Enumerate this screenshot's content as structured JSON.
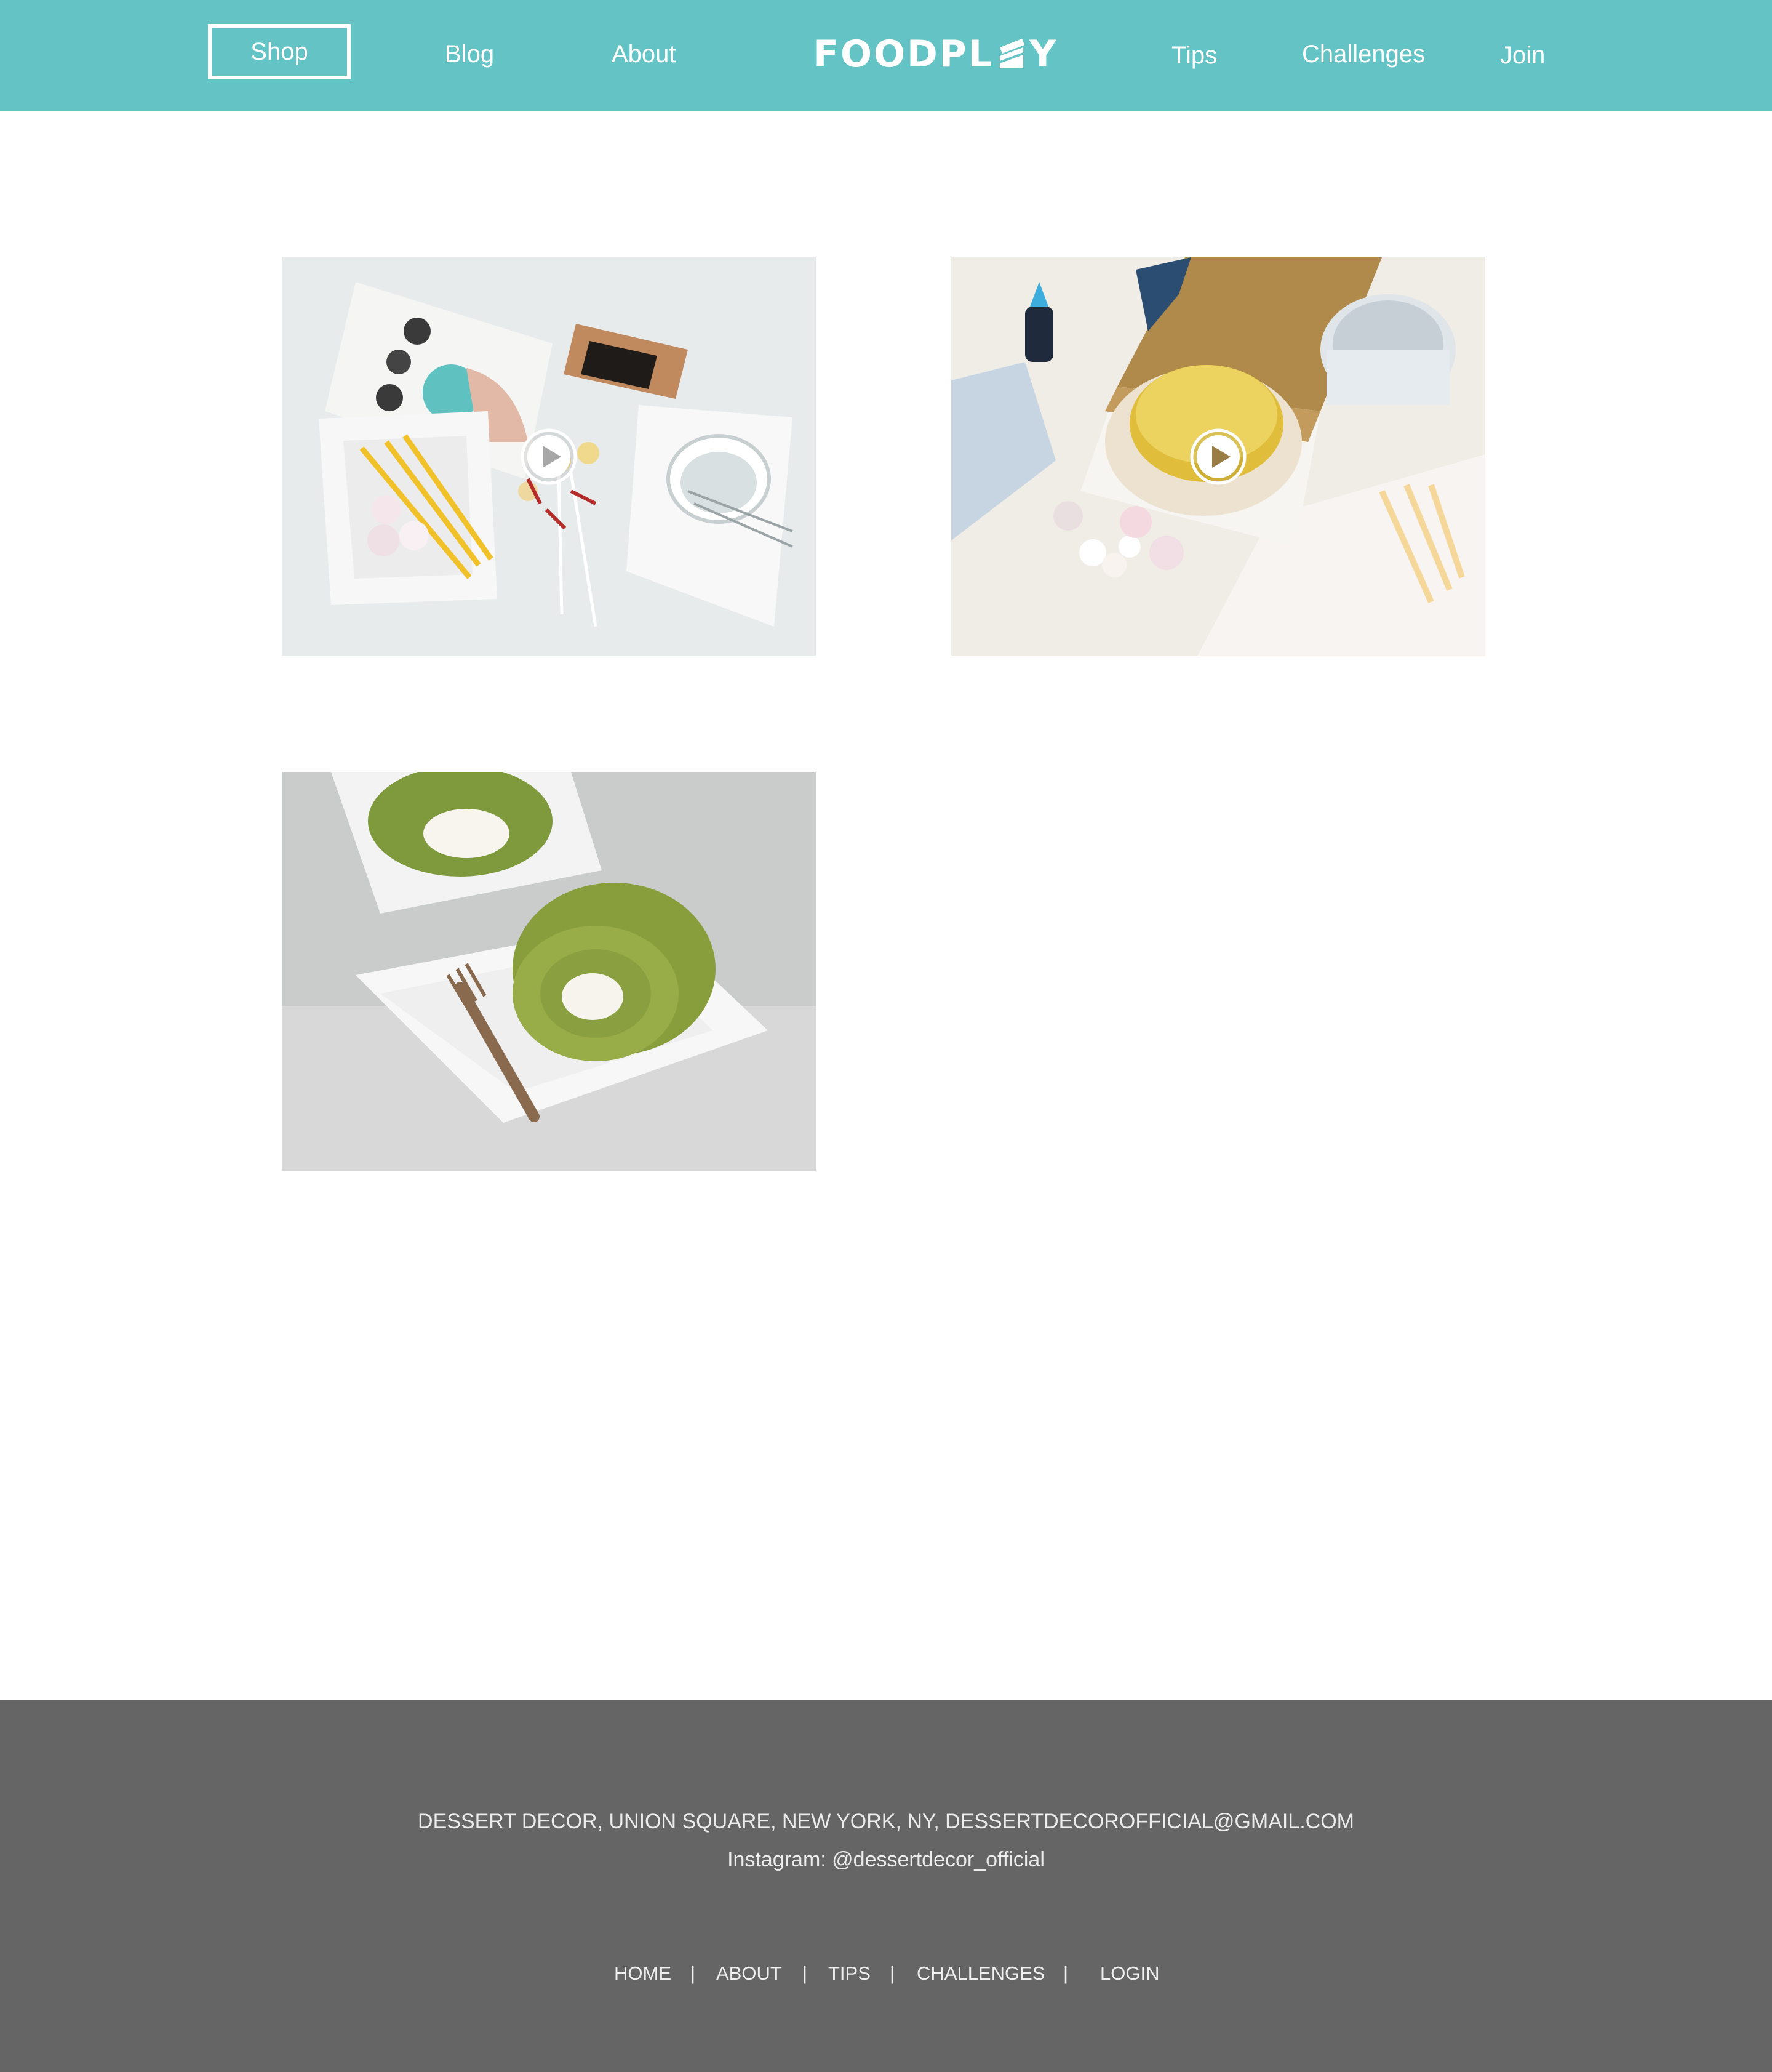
{
  "header": {
    "nav_left": [
      {
        "label": "Shop",
        "active": true
      },
      {
        "label": "Blog"
      },
      {
        "label": "About"
      }
    ],
    "logo": {
      "text_before": "FOODPL",
      "text_after": "Y",
      "mark_icon": "cake-slice-icon"
    },
    "nav_right": [
      {
        "label": "Tips"
      },
      {
        "label": "Challenges"
      },
      {
        "label": "Join"
      }
    ]
  },
  "gallery": {
    "items": [
      {
        "subject": "dessert kit flat lay",
        "has_video": true,
        "icon": "play-icon"
      },
      {
        "subject": "cake in box with decorating tools",
        "has_video": true,
        "icon": "play-icon"
      },
      {
        "subject": "matcha swiss roll",
        "has_video": false
      }
    ]
  },
  "footer": {
    "address": "DESSERT DECOR, UNION SQUARE, NEW YORK, NY, DESSERTDECOROFFICIAL@GMAIL.COM",
    "instagram": "Instagram: @dessertdecor_official",
    "links": [
      "HOME",
      "ABOUT",
      "TIPS",
      "CHALLENGES",
      "LOGIN"
    ],
    "separator": "|"
  },
  "colors": {
    "header_bg": "#64c3c4",
    "footer_bg": "#656565",
    "text_light": "#ffffff"
  }
}
